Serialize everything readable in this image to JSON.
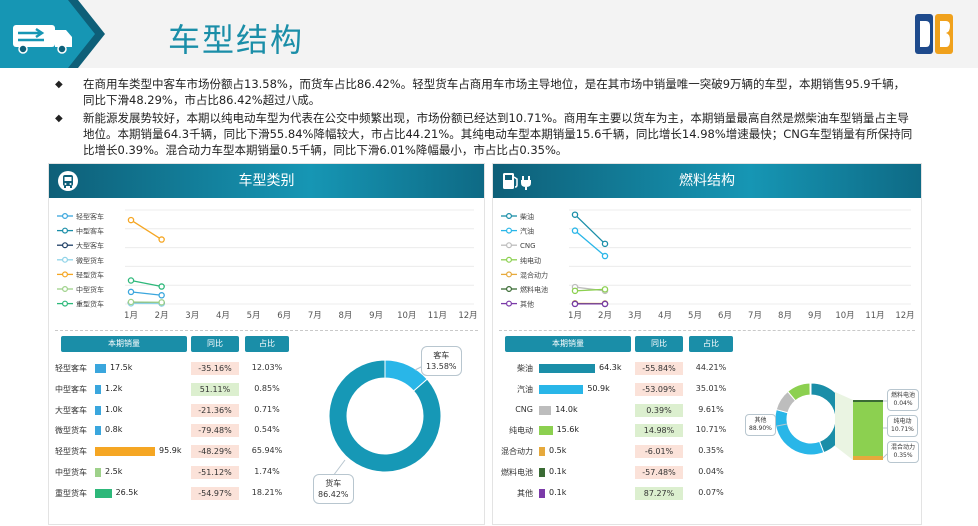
{
  "page": {
    "title": "车型结构",
    "bullets": [
      "在商用车类型中客车市场份额占13.58%，而货车占比86.42%。轻型货车占商用车市场主导地位，是在其市场中销量唯一突破9万辆的车型，本期销售95.9千辆，同比下滑48.29%，市占比86.42%超过八成。",
      "新能源发展势较好，本期以纯电动车型为代表在公交中频繁出现，市场份额已经达到10.71%。商用车主要以货车为主，本期销量最高自然是燃柴油车型销量占主导地位。本期销量64.3千辆，同比下滑55.84%降幅较大，市占比44.21%。其纯电动车型本期销量15.6千辆，同比增长14.98%增速最快；CNG车型销量有所保持同比增长0.39%。混合动力车型本期销量0.5千辆，同比下滑6.01%降幅最小，市占比占0.35%。"
    ],
    "left_panel_title": "车型类别",
    "right_panel_title": "燃料结构",
    "colors": {
      "accent": "#1a8ea8",
      "dark_teal": "#0e5f78"
    }
  },
  "icons": {
    "header_logo": "truck-arrow-icon",
    "brand": "db-logo-icon",
    "left_panel": "bus-icon",
    "right_panel": "fuel-charge-icon"
  },
  "left_table": {
    "headers": [
      "本期销量",
      "同比",
      "占比"
    ],
    "rows": [
      {
        "label": "轻型客车",
        "value": 17.5,
        "value_text": "17.5k",
        "yoy": "-35.16%",
        "share": "12.03%",
        "color": "#3aa6dd"
      },
      {
        "label": "中型客车",
        "value": 1.2,
        "value_text": "1.2k",
        "yoy": "51.11%",
        "share": "0.85%",
        "color": "#3aa6dd"
      },
      {
        "label": "大型客车",
        "value": 1.0,
        "value_text": "1.0k",
        "yoy": "-21.36%",
        "share": "0.71%",
        "color": "#3aa6dd"
      },
      {
        "label": "微型货车",
        "value": 0.8,
        "value_text": "0.8k",
        "yoy": "-79.48%",
        "share": "0.54%",
        "color": "#3aa6dd"
      },
      {
        "label": "轻型货车",
        "value": 95.9,
        "value_text": "95.9k",
        "yoy": "-48.29%",
        "share": "65.94%",
        "color": "#f5a623"
      },
      {
        "label": "中型货车",
        "value": 2.5,
        "value_text": "2.5k",
        "yoy": "-51.12%",
        "share": "1.74%",
        "color": "#9ed18a"
      },
      {
        "label": "重型货车",
        "value": 26.5,
        "value_text": "26.5k",
        "yoy": "-54.97%",
        "share": "18.21%",
        "color": "#2db87a"
      }
    ]
  },
  "right_table": {
    "headers": [
      "本期销量",
      "同比",
      "占比"
    ],
    "rows": [
      {
        "label": "柴油",
        "value": 64.3,
        "value_text": "64.3k",
        "yoy": "-55.84%",
        "share": "44.21%",
        "color": "#1a8ea8"
      },
      {
        "label": "汽油",
        "value": 50.9,
        "value_text": "50.9k",
        "yoy": "-53.09%",
        "share": "35.01%",
        "color": "#29b6e8"
      },
      {
        "label": "CNG",
        "value": 14.0,
        "value_text": "14.0k",
        "yoy": "0.39%",
        "share": "9.61%",
        "color": "#bdbdbd"
      },
      {
        "label": "纯电动",
        "value": 15.6,
        "value_text": "15.6k",
        "yoy": "14.98%",
        "share": "10.71%",
        "color": "#8cd050"
      },
      {
        "label": "混合动力",
        "value": 0.5,
        "value_text": "0.5k",
        "yoy": "-6.01%",
        "share": "0.35%",
        "color": "#e6a93c"
      },
      {
        "label": "燃料电池",
        "value": 0.1,
        "value_text": "0.1k",
        "yoy": "-57.48%",
        "share": "0.04%",
        "color": "#3a6b34"
      },
      {
        "label": "其他",
        "value": 0.1,
        "value_text": "0.1k",
        "yoy": "87.27%",
        "share": "0.07%",
        "color": "#7b3aa8"
      }
    ]
  },
  "callouts": {
    "bus": {
      "name": "客车",
      "value": "13.58%"
    },
    "truck": {
      "name": "货车",
      "value": "86.42%"
    },
    "other": {
      "name": "其他",
      "value": "88.90%"
    },
    "fuel_cell": {
      "name": "燃料电池",
      "value": "0.04%"
    },
    "ev": {
      "name": "纯电动",
      "value": "10.71%"
    },
    "hybrid": {
      "name": "混合动力",
      "value": "0.35%"
    }
  },
  "chart_data": [
    {
      "type": "line",
      "x": [
        "1月",
        "2月",
        "3月",
        "4月",
        "5月",
        "6月",
        "7月",
        "8月",
        "9月",
        "10月",
        "11月",
        "12月"
      ],
      "ylim": [
        0,
        140
      ],
      "grid": true,
      "legend_position": "left",
      "series": [
        {
          "name": "轻型客车",
          "color": "#3aa6dd",
          "values": [
            18,
            13
          ]
        },
        {
          "name": "中型客车",
          "color": "#1a8ea8",
          "values": [
            2,
            1.5
          ]
        },
        {
          "name": "大型客车",
          "color": "#1e3f66",
          "values": [
            1.5,
            1
          ]
        },
        {
          "name": "微型货车",
          "color": "#8fd3e8",
          "values": [
            1,
            0.8
          ]
        },
        {
          "name": "轻型货车",
          "color": "#f5a623",
          "values": [
            125,
            96
          ]
        },
        {
          "name": "中型货车",
          "color": "#9ed18a",
          "values": [
            3,
            2.5
          ]
        },
        {
          "name": "重型货车",
          "color": "#2db87a",
          "values": [
            35,
            26
          ]
        }
      ]
    },
    {
      "type": "line",
      "x": [
        "1月",
        "2月",
        "3月",
        "4月",
        "5月",
        "6月",
        "7月",
        "8月",
        "9月",
        "10月",
        "11月",
        "12月"
      ],
      "ylim": [
        0,
        100
      ],
      "grid": true,
      "legend_position": "left",
      "series": [
        {
          "name": "柴油",
          "color": "#1a8ea8",
          "values": [
            95,
            64
          ]
        },
        {
          "name": "汽油",
          "color": "#29b6e8",
          "values": [
            78,
            51
          ]
        },
        {
          "name": "CNG",
          "color": "#bdbdbd",
          "values": [
            18,
            14
          ]
        },
        {
          "name": "纯电动",
          "color": "#8cd050",
          "values": [
            14,
            15.6
          ]
        },
        {
          "name": "混合动力",
          "color": "#e6a93c",
          "values": [
            0.6,
            0.5
          ]
        },
        {
          "name": "燃料电池",
          "color": "#3a6b34",
          "values": [
            0.2,
            0.1
          ]
        },
        {
          "name": "其他",
          "color": "#7b3aa8",
          "values": [
            0.1,
            0.1
          ]
        }
      ]
    },
    {
      "type": "pie",
      "categories": [
        "客车",
        "货车"
      ],
      "values": [
        13.58,
        86.42
      ],
      "colors": [
        "#29b6e8",
        "#1698b6"
      ]
    },
    {
      "type": "pie",
      "categories": [
        "柴油",
        "汽油",
        "CNG",
        "纯电动",
        "混合动力",
        "燃料电池",
        "其他"
      ],
      "values": [
        44.21,
        35.01,
        9.61,
        10.71,
        0.35,
        0.04,
        0.07
      ],
      "colors": [
        "#1a8ea8",
        "#29b6e8",
        "#bdbdbd",
        "#8cd050",
        "#e6a93c",
        "#3a6b34",
        "#7b3aa8"
      ]
    }
  ]
}
